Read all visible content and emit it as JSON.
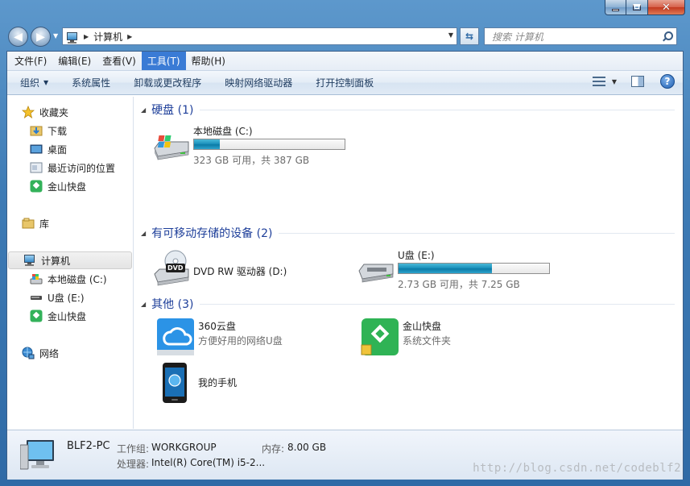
{
  "window": {
    "caption": {
      "minimize": "▁",
      "maximize": "□",
      "close": "✕"
    }
  },
  "address_bar": {
    "back_icon": "back-arrow-icon",
    "forward_icon": "forward-arrow-icon",
    "path": "计算机",
    "refresh_glyph": "⇆",
    "search_placeholder": "搜索 计算机"
  },
  "menu": {
    "items": [
      "文件(F)",
      "编辑(E)",
      "查看(V)",
      "工具(T)",
      "帮助(H)"
    ],
    "active": "工具(T)"
  },
  "toolbar": {
    "organize": "组织",
    "system_properties": "系统属性",
    "uninstall": "卸载或更改程序",
    "map_drive": "映射网络驱动器",
    "control_panel": "打开控制面板"
  },
  "nav": {
    "favorites": "收藏夹",
    "downloads": "下载",
    "desktop": "桌面",
    "recent": "最近访问的位置",
    "kingsoft": "金山快盘",
    "library": "库",
    "computer": "计算机",
    "local_disk": "本地磁盘 (C:)",
    "usb": "U盘 (E:)",
    "kingsoft2": "金山快盘",
    "network": "网络"
  },
  "groups": {
    "hard_disks": "硬盘 (1)",
    "removable": "有可移动存储的设备 (2)",
    "other": "其他 (3)"
  },
  "drives": {
    "c": {
      "name": "本地磁盘 (C:)",
      "free_text": "323 GB 可用，共 387 GB",
      "used_fraction": 0.17
    },
    "dvd": {
      "name": "DVD RW 驱动器 (D:)",
      "badge": "DVD"
    },
    "e": {
      "name": "U盘 (E:)",
      "free_text": "2.73 GB 可用，共 7.25 GB",
      "used_fraction": 0.62
    }
  },
  "others": {
    "cloud360": {
      "name": "360云盘",
      "sub": "方便好用的网络U盘"
    },
    "kingsoft": {
      "name": "金山快盘",
      "sub": "系统文件夹"
    },
    "phone": {
      "name": "我的手机"
    }
  },
  "details": {
    "pc_name": "BLF2-PC",
    "workgroup_label": "工作组:",
    "workgroup": "WORKGROUP",
    "memory_label": "内存:",
    "memory": "8.00 GB",
    "cpu_label": "处理器:",
    "cpu": "Intel(R) Core(TM) i5-2..."
  },
  "watermark": "http://blog.csdn.net/codeblf2",
  "colors": {
    "accent": "#3a7bd5",
    "group_header": "#1e3f9a",
    "bar_fill": "#1c92bd"
  }
}
